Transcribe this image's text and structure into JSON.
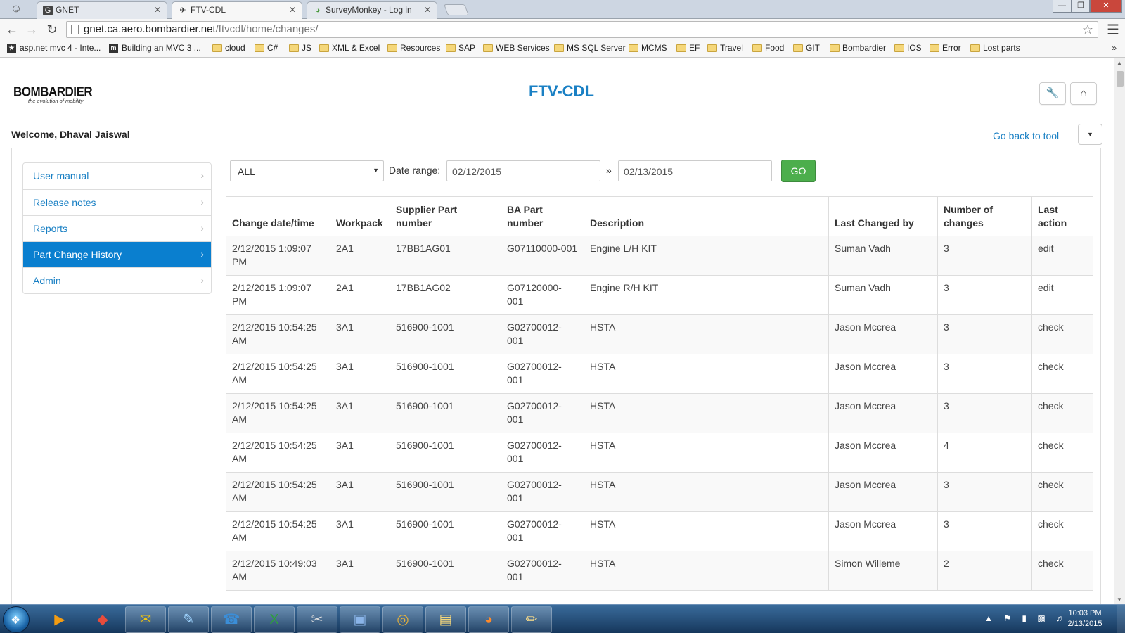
{
  "browser": {
    "tabs": [
      {
        "title": "GNET",
        "icon": "gnet-icon"
      },
      {
        "title": "FTV-CDL",
        "icon": "airplane-icon"
      },
      {
        "title": "SurveyMonkey - Log in",
        "icon": "surveymonkey-icon"
      }
    ],
    "active_tab": 1,
    "url_host": "gnet.ca.aero.bombardier.net",
    "url_path": "/ftvcdl/home/changes/",
    "bookmarks": [
      {
        "label": "asp.net mvc 4 - Inte...",
        "icon": "site-icon"
      },
      {
        "label": "Building an MVC 3 ...",
        "icon": "site-icon"
      },
      {
        "label": "cloud",
        "icon": "folder-icon"
      },
      {
        "label": "C#",
        "icon": "folder-icon"
      },
      {
        "label": "JS",
        "icon": "folder-icon"
      },
      {
        "label": "XML & Excel",
        "icon": "folder-icon"
      },
      {
        "label": "Resources",
        "icon": "folder-icon"
      },
      {
        "label": "SAP",
        "icon": "folder-icon"
      },
      {
        "label": "WEB Services",
        "icon": "folder-icon"
      },
      {
        "label": "MS SQL Server",
        "icon": "folder-icon"
      },
      {
        "label": "MCMS",
        "icon": "folder-icon"
      },
      {
        "label": "EF",
        "icon": "folder-icon"
      },
      {
        "label": "Travel",
        "icon": "folder-icon"
      },
      {
        "label": "Food",
        "icon": "folder-icon"
      },
      {
        "label": "GIT",
        "icon": "folder-icon"
      },
      {
        "label": "Bombardier",
        "icon": "folder-icon"
      },
      {
        "label": "IOS",
        "icon": "folder-icon"
      },
      {
        "label": "Error",
        "icon": "folder-icon"
      },
      {
        "label": "Lost parts",
        "icon": "folder-icon"
      }
    ],
    "bookmarks_more": "»"
  },
  "header": {
    "logo": "BOMBARDIER",
    "logo_tagline": "the evolution of mobility",
    "title": "FTV-CDL",
    "welcome": "Welcome, Dhaval Jaiswal",
    "go_back": "Go back to tool"
  },
  "sidebar": {
    "items": [
      {
        "label": "User manual",
        "active": false
      },
      {
        "label": "Release notes",
        "active": false
      },
      {
        "label": "Reports",
        "active": false
      },
      {
        "label": "Part Change History",
        "active": true
      },
      {
        "label": "Admin",
        "active": false
      }
    ]
  },
  "filter": {
    "select_value": "ALL",
    "date_range_label": "Date range:",
    "date_from": "02/12/2015",
    "separator": "»",
    "date_to": "02/13/2015",
    "go_label": "GO"
  },
  "table": {
    "columns": [
      "Change date/time",
      "Workpack",
      "Supplier Part number",
      "BA Part number",
      "Description",
      "Last Changed by",
      "Number of changes",
      "Last action"
    ],
    "rows": [
      [
        "2/12/2015 1:09:07 PM",
        "2A1",
        "17BB1AG01",
        "G07110000-001",
        "Engine L/H KIT",
        "Suman Vadh",
        "3",
        "edit"
      ],
      [
        "2/12/2015 1:09:07 PM",
        "2A1",
        "17BB1AG02",
        "G07120000-001",
        "Engine R/H KIT",
        "Suman Vadh",
        "3",
        "edit"
      ],
      [
        "2/12/2015 10:54:25 AM",
        "3A1",
        "516900-1001",
        "G02700012-001",
        "HSTA",
        "Jason Mccrea",
        "3",
        "check"
      ],
      [
        "2/12/2015 10:54:25 AM",
        "3A1",
        "516900-1001",
        "G02700012-001",
        "HSTA",
        "Jason Mccrea",
        "3",
        "check"
      ],
      [
        "2/12/2015 10:54:25 AM",
        "3A1",
        "516900-1001",
        "G02700012-001",
        "HSTA",
        "Jason Mccrea",
        "3",
        "check"
      ],
      [
        "2/12/2015 10:54:25 AM",
        "3A1",
        "516900-1001",
        "G02700012-001",
        "HSTA",
        "Jason Mccrea",
        "4",
        "check"
      ],
      [
        "2/12/2015 10:54:25 AM",
        "3A1",
        "516900-1001",
        "G02700012-001",
        "HSTA",
        "Jason Mccrea",
        "3",
        "check"
      ],
      [
        "2/12/2015 10:54:25 AM",
        "3A1",
        "516900-1001",
        "G02700012-001",
        "HSTA",
        "Jason Mccrea",
        "3",
        "check"
      ],
      [
        "2/12/2015 10:49:03 AM",
        "3A1",
        "516900-1001",
        "G02700012-001",
        "HSTA",
        "Simon Willeme",
        "2",
        "check"
      ]
    ]
  },
  "taskbar": {
    "apps": [
      "media-player-icon",
      "git-icon",
      "outlook-icon",
      "notepad-icon",
      "lync-icon",
      "excel-icon",
      "snipping-tool-icon",
      "remote-desktop-icon",
      "chrome-icon",
      "explorer-icon",
      "firefox-icon",
      "paint-icon"
    ],
    "clock_time": "10:03 PM",
    "clock_date": "2/13/2015"
  },
  "colors": {
    "link": "#1a80c4",
    "active_nav": "#0a7fcf",
    "go_button": "#4cae4c"
  }
}
